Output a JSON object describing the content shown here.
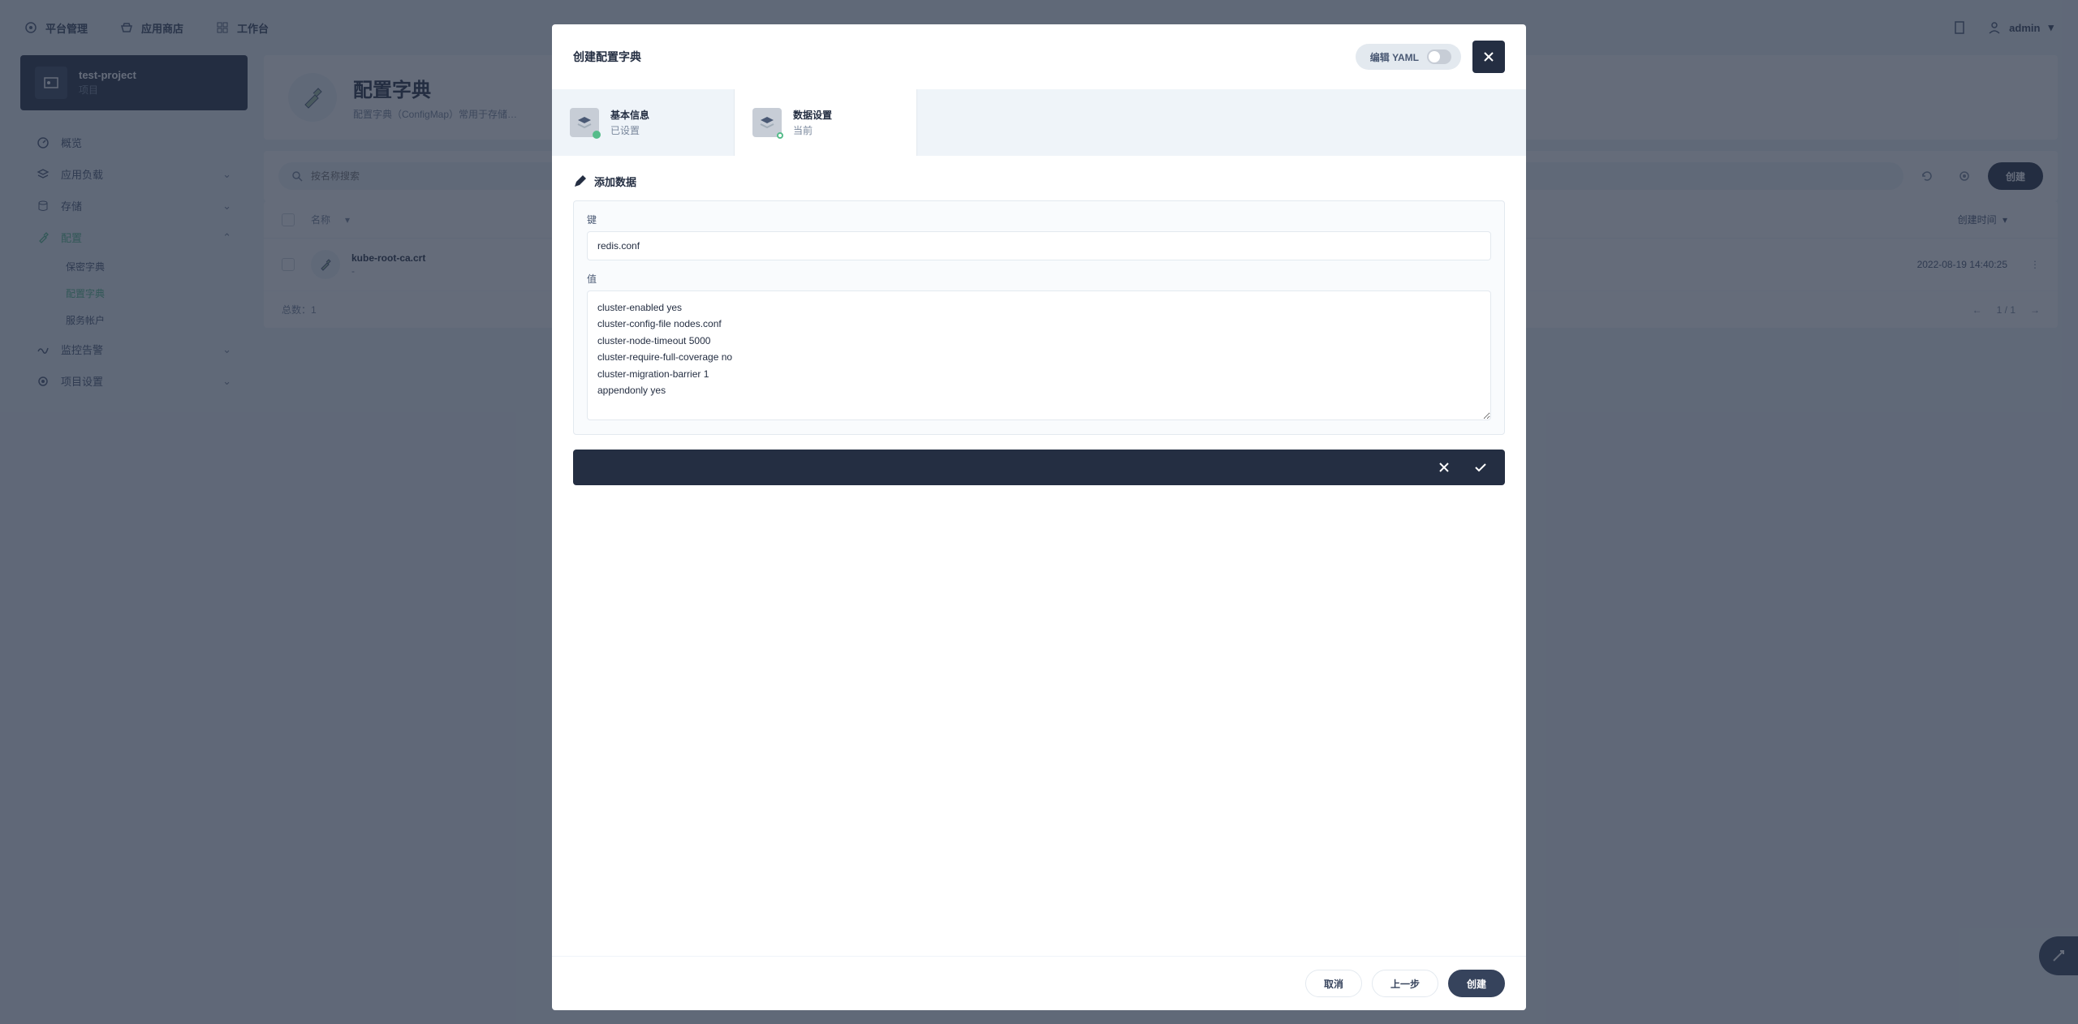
{
  "topnav": {
    "items": [
      {
        "label": "平台管理"
      },
      {
        "label": "应用商店"
      },
      {
        "label": "工作台"
      }
    ],
    "user": "admin"
  },
  "project": {
    "name": "test-project",
    "type": "项目"
  },
  "sidebar": {
    "overview": "概览",
    "workloads": "应用负载",
    "storage": "存储",
    "config": "配置",
    "configSubs": {
      "secrets": "保密字典",
      "configmaps": "配置字典",
      "serviceaccounts": "服务帐户"
    },
    "monitor": "监控告警",
    "settings": "项目设置"
  },
  "page": {
    "title": "配置字典",
    "desc": "配置字典（ConfigMap）常用于存储…"
  },
  "toolbar": {
    "searchPlaceholder": "按名称搜索",
    "create": "创建"
  },
  "table": {
    "nameHeader": "名称",
    "timeHeader": "创建时间",
    "rows": [
      {
        "name": "kube-root-ca.crt",
        "sub": "-",
        "time": "2022-08-19 14:40:25"
      }
    ],
    "totalLabel": "总数：",
    "total": "1",
    "page": "1 / 1"
  },
  "modal": {
    "title": "创建配置字典",
    "yamlLabel": "编辑 YAML",
    "steps": [
      {
        "name": "基本信息",
        "sub": "已设置"
      },
      {
        "name": "数据设置",
        "sub": "当前"
      }
    ],
    "sectionTitle": "添加数据",
    "form": {
      "keyLabel": "键",
      "key": "redis.conf",
      "valueLabel": "值",
      "value": "cluster-enabled yes\ncluster-config-file nodes.conf\ncluster-node-timeout 5000\ncluster-require-full-coverage no\ncluster-migration-barrier 1\nappendonly yes"
    },
    "buttons": {
      "cancel": "取消",
      "prev": "上一步",
      "create": "创建"
    }
  }
}
